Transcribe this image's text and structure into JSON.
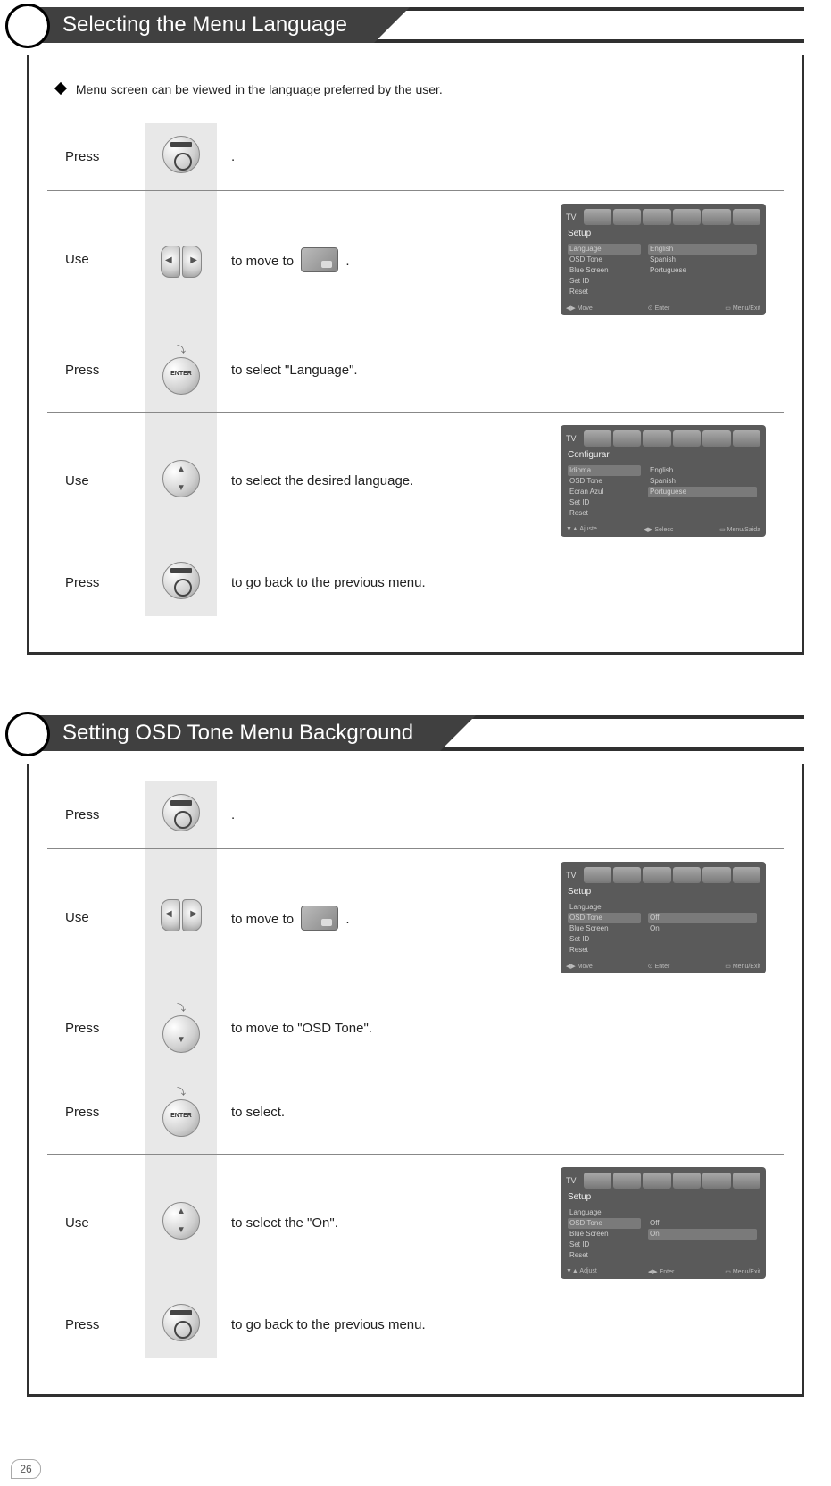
{
  "page_number": "26",
  "section1": {
    "title": "Selecting the Menu Language",
    "intro": "Menu screen can be viewed in the language preferred by the user.",
    "steps": [
      {
        "action": "Press",
        "button": "menu",
        "desc_suffix": "."
      },
      {
        "action": "Use",
        "button": "lr",
        "desc_prefix": "to move to ",
        "desc_suffix": "."
      },
      {
        "action": "Press",
        "button": "enter",
        "desc": "to select \"Language\"."
      },
      {
        "action": "Use",
        "button": "updown",
        "desc": "to select the desired language."
      },
      {
        "action": "Press",
        "button": "menu",
        "desc": "to go back to the previous menu."
      }
    ],
    "osd1": {
      "tv": "TV",
      "header": "Setup",
      "items": [
        "Language",
        "OSD Tone",
        "Blue Screen",
        "Set ID",
        "Reset"
      ],
      "highlight": "Language",
      "options": [
        "English",
        "Spanish",
        "Portuguese"
      ],
      "option_highlight": "English",
      "foot": [
        "◀▶ Move",
        "⊙ Enter",
        "▭ Menu/Exit"
      ]
    },
    "osd2": {
      "tv": "TV",
      "header": "Configurar",
      "items": [
        "Idioma",
        "OSD Tone",
        "Ecran Azul",
        "Set ID",
        "Reset"
      ],
      "highlight": "Idioma",
      "options": [
        "English",
        "Spanish",
        "Portuguese"
      ],
      "option_highlight": "Portuguese",
      "foot": [
        "▼▲ Ajuste",
        "◀▶ Selecc",
        "▭ Menu/Saida"
      ]
    }
  },
  "section2": {
    "title": "Setting OSD Tone Menu Background",
    "steps": [
      {
        "action": "Press",
        "button": "menu",
        "desc_suffix": "."
      },
      {
        "action": "Use",
        "button": "lr",
        "desc_prefix": "to move to ",
        "desc_suffix": "."
      },
      {
        "action": "Press",
        "button": "down",
        "desc": "to move to \"OSD Tone\"."
      },
      {
        "action": "Press",
        "button": "enter",
        "desc": "to select."
      },
      {
        "action": "Use",
        "button": "updown",
        "desc": "to select the \"On\"."
      },
      {
        "action": "Press",
        "button": "menu",
        "desc": "to go back to the previous menu."
      }
    ],
    "osd1": {
      "tv": "TV",
      "header": "Setup",
      "items": [
        "Language",
        "OSD Tone",
        "Blue Screen",
        "Set ID",
        "Reset"
      ],
      "highlight": "OSD Tone",
      "options": [
        "Off",
        "On"
      ],
      "option_highlight": "Off",
      "foot": [
        "◀▶ Move",
        "⊙ Enter",
        "▭ Menu/Exit"
      ]
    },
    "osd2": {
      "tv": "TV",
      "header": "Setup",
      "items": [
        "Language",
        "OSD Tone",
        "Blue Screen",
        "Set ID",
        "Reset"
      ],
      "highlight": "OSD Tone",
      "options": [
        "Off",
        "On"
      ],
      "option_highlight": "On",
      "foot": [
        "▼▲ Adjust",
        "◀▶ Enter",
        "▭ Menu/Exit"
      ]
    }
  }
}
